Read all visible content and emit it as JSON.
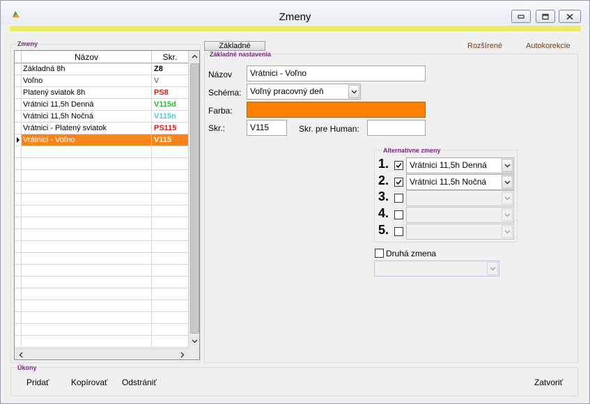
{
  "window": {
    "title": "Zmeny"
  },
  "list_group": {
    "label": "Zmeny",
    "columns": {
      "name": "Názov",
      "code": "Skr."
    },
    "rows": [
      {
        "name": "Základná 8h",
        "code": "Z8",
        "code_color": "#000000",
        "selected": false
      },
      {
        "name": "Voľno",
        "code": "V",
        "code_color": "#808080",
        "selected": false
      },
      {
        "name": "Platený sviatok 8h",
        "code": "PS8",
        "code_color": "#e01818",
        "selected": false
      },
      {
        "name": "Vrátnici 11,5h Denná",
        "code": "V115d",
        "code_color": "#22c02a",
        "selected": false
      },
      {
        "name": "Vrátnici 11,5h Nočná",
        "code": "V115n",
        "code_color": "#2cd6e0",
        "selected": false
      },
      {
        "name": "Vrátnici - Platený sviatok",
        "code": "PS115",
        "code_color": "#e01818",
        "selected": false
      },
      {
        "name": "Vrátnici - Voľno",
        "code": "V115",
        "code_color": "#ffffff",
        "selected": true
      }
    ],
    "empty_rows": 17
  },
  "tabs": {
    "basic": "Základné",
    "extended": "Rozšírené",
    "autocorrect": "Autokorekcie"
  },
  "basic_settings": {
    "label": "Základné nastavenia",
    "name_label": "Názov",
    "name_value": "Vrátnici - Voľno",
    "schema_label": "Schéma:",
    "schema_value": "Voľný pracovný deň",
    "color_label": "Farba:",
    "color_value": "#ff8000",
    "code_label": "Skr.:",
    "code_value": "V115",
    "human_code_label": "Skr. pre Human:",
    "human_code_value": ""
  },
  "alternatives": {
    "label": "Alternatívne zmeny",
    "items": [
      {
        "num": "1.",
        "checked": true,
        "value": "Vrátnici 11,5h Denná",
        "enabled": true
      },
      {
        "num": "2.",
        "checked": true,
        "value": "Vrátnici 11,5h Nočná",
        "enabled": true
      },
      {
        "num": "3.",
        "checked": false,
        "value": "",
        "enabled": false
      },
      {
        "num": "4.",
        "checked": false,
        "value": "",
        "enabled": false
      },
      {
        "num": "5.",
        "checked": false,
        "value": "",
        "enabled": false
      }
    ]
  },
  "second_shift": {
    "label": "Druhá zmena",
    "checked": false,
    "value": ""
  },
  "actions": {
    "label": "Úkony",
    "add": "Pridať",
    "copy": "Kopírovať",
    "remove": "Odstrániť",
    "close": "Zatvoriť"
  }
}
